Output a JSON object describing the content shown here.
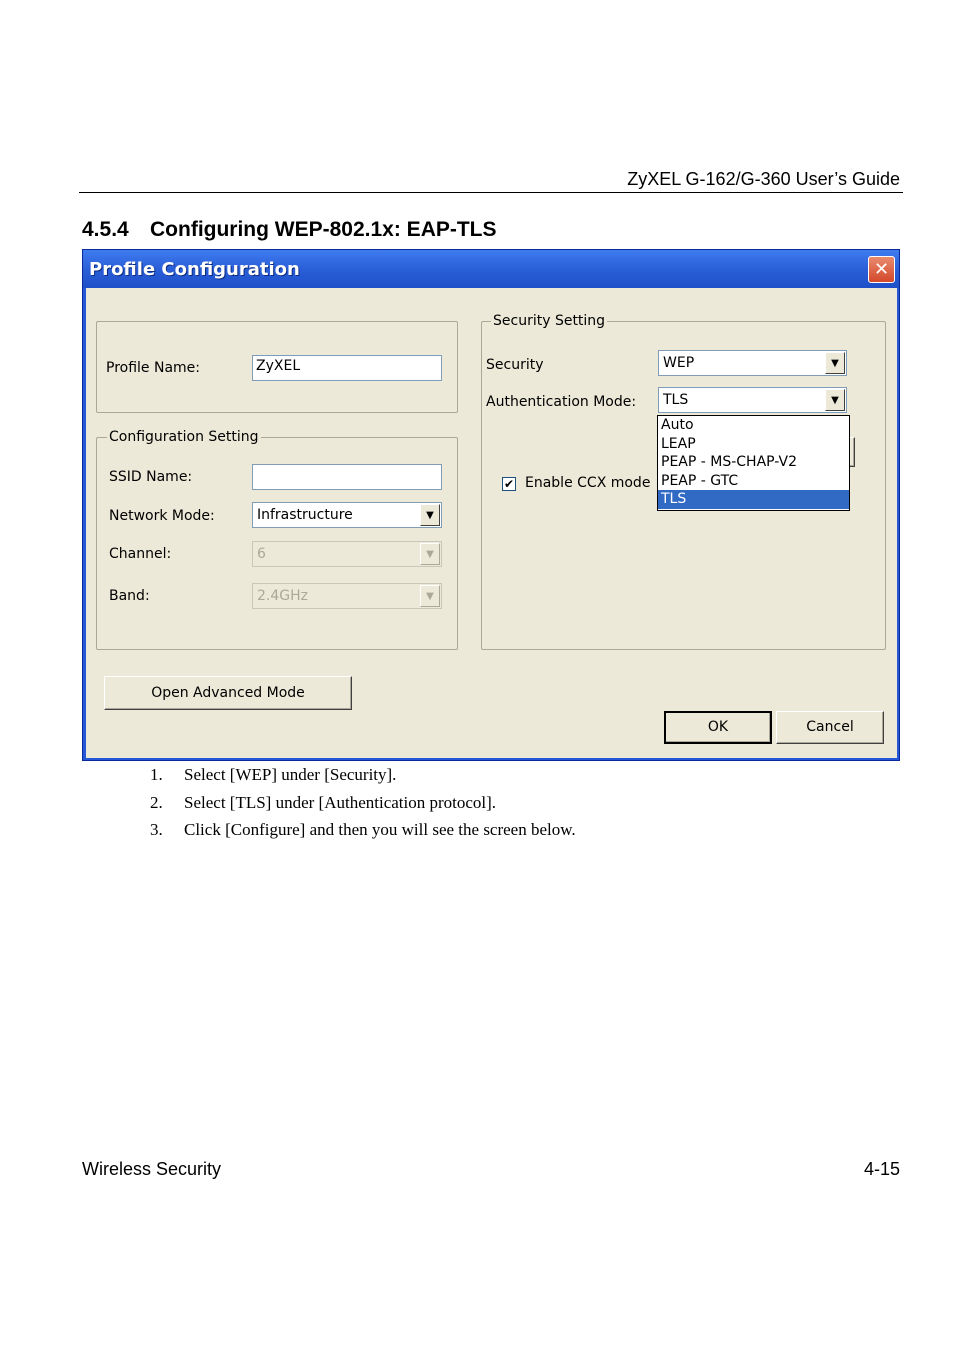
{
  "page": {
    "running_header": "ZyXEL G-162/G-360 User’s Guide",
    "section_number": "4.5.4",
    "section_title": "Configuring WEP-802.1x: EAP-TLS",
    "footer_left": "Wireless Security",
    "footer_right": "4-15"
  },
  "dialog": {
    "title": "Profile Configuration",
    "close_glyph": "✕",
    "profile_name_label": "Profile Name:",
    "profile_name_value": "ZyXEL",
    "config_group_label": "Configuration Setting",
    "ssid_label": "SSID Name:",
    "ssid_value": "",
    "network_mode_label": "Network Mode:",
    "network_mode_value": "Infrastructure",
    "channel_label": "Channel:",
    "channel_value": "6",
    "band_label": "Band:",
    "band_value": "2.4GHz",
    "security_group_label": "Security Setting",
    "security_label": "Security",
    "security_value": "WEP",
    "auth_mode_label": "Authentication Mode:",
    "auth_mode_value": "TLS",
    "auth_mode_options": [
      "Auto",
      "LEAP",
      "PEAP - MS-CHAP-V2",
      "PEAP - GTC",
      "TLS"
    ],
    "auth_mode_selected_index": 4,
    "ccx_label": "Enable CCX mode",
    "ccx_checked": true,
    "advanced_button": "Open Advanced Mode",
    "ok_button": "OK",
    "cancel_button": "Cancel",
    "dropdown_arrow": "▼"
  },
  "steps": [
    {
      "num": "1.",
      "text": "Select [WEP] under [Security]."
    },
    {
      "num": "2.",
      "text": "Select [TLS] under [Authentication protocol]."
    },
    {
      "num": "3.",
      "text": "Click [Configure] and then you will see the screen below."
    }
  ],
  "colors": {
    "titlebar": "#2a5fd8",
    "dialog_face": "#ece9d8",
    "selection": "#316ac5",
    "close_button": "#d4482a"
  }
}
